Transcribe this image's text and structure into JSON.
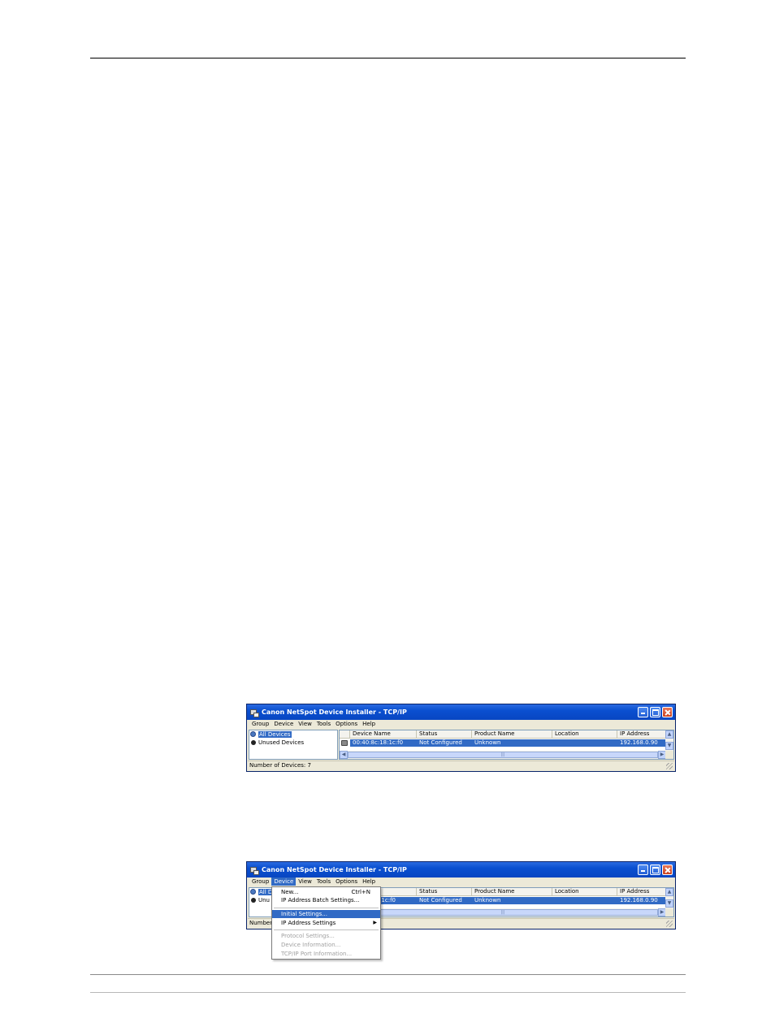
{
  "window": {
    "title": "Canon NetSpot Device Installer - TCP/IP",
    "menu": [
      "Group",
      "Device",
      "View",
      "Tools",
      "Options",
      "Help"
    ],
    "tree": [
      "All Devices",
      "Unused Devices"
    ],
    "tree_truncated": [
      "All D",
      "Unu"
    ],
    "columns": [
      "Device Name",
      "Status",
      "Product Name",
      "Location",
      "IP Address"
    ],
    "row": {
      "device_name": "00:40:8c:18:1c:f0",
      "device_name_truncated": "1c:f0",
      "status": "Not Configured",
      "product_name": "Unknown",
      "location": "",
      "ip_address": "192.168.0.90"
    },
    "status_bar": "Number of Devices: 7",
    "status_bar_truncated": "Number",
    "scroll_up": "▲",
    "scroll_down": "▼",
    "scroll_left": "◀",
    "scroll_right": "▶",
    "scroll_thumb_grip": "|||"
  },
  "device_menu": {
    "items": [
      {
        "label": "New...",
        "shortcut": "Ctrl+N",
        "state": "normal"
      },
      {
        "label": "IP Address Batch Settings...",
        "state": "normal"
      },
      {
        "label": "Initial Settings...",
        "state": "highlighted"
      },
      {
        "label": "IP Address Settings",
        "state": "normal",
        "submenu": "▶"
      },
      {
        "label": "Protocol Settings...",
        "state": "disabled"
      },
      {
        "label": "Device Information...",
        "state": "disabled"
      },
      {
        "label": "TCP/IP Port Information...",
        "state": "disabled"
      }
    ]
  },
  "colors": {
    "titlebar": "#0a4fd0",
    "selection": "#316ac5",
    "window_face": "#ece9d8",
    "close_button": "#c9401c"
  }
}
